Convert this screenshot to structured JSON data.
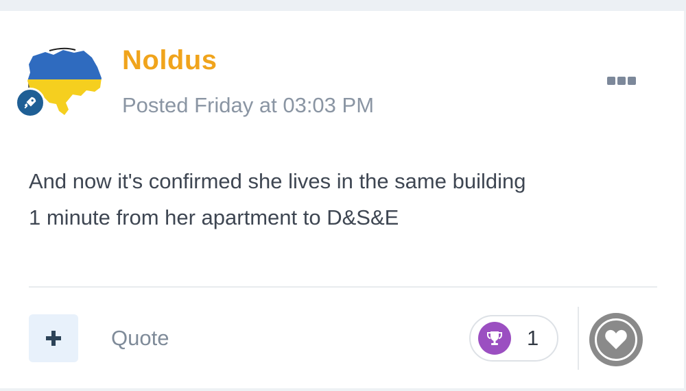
{
  "post": {
    "author": "Noldus",
    "posted": "Posted Friday at 03:03 PM",
    "body_lines": [
      "And now it's confirmed she lives in the same building",
      "1 minute from her apartment to D&S&E"
    ]
  },
  "footer": {
    "quote_label": "Quote",
    "reaction_count": "1"
  },
  "icons": {
    "avatar": "ukraine-flag-map",
    "rank_badge": "rocket-icon",
    "menu": "ellipsis-icon",
    "plus": "plus-icon",
    "reaction": "trophy-icon",
    "like": "heart-icon"
  },
  "colors": {
    "author": "#f0a41c",
    "flag_blue": "#2f6bbf",
    "flag_yellow": "#f5cf1f",
    "badge": "#1f5f95",
    "trophy_bg": "#9b4fc1"
  }
}
